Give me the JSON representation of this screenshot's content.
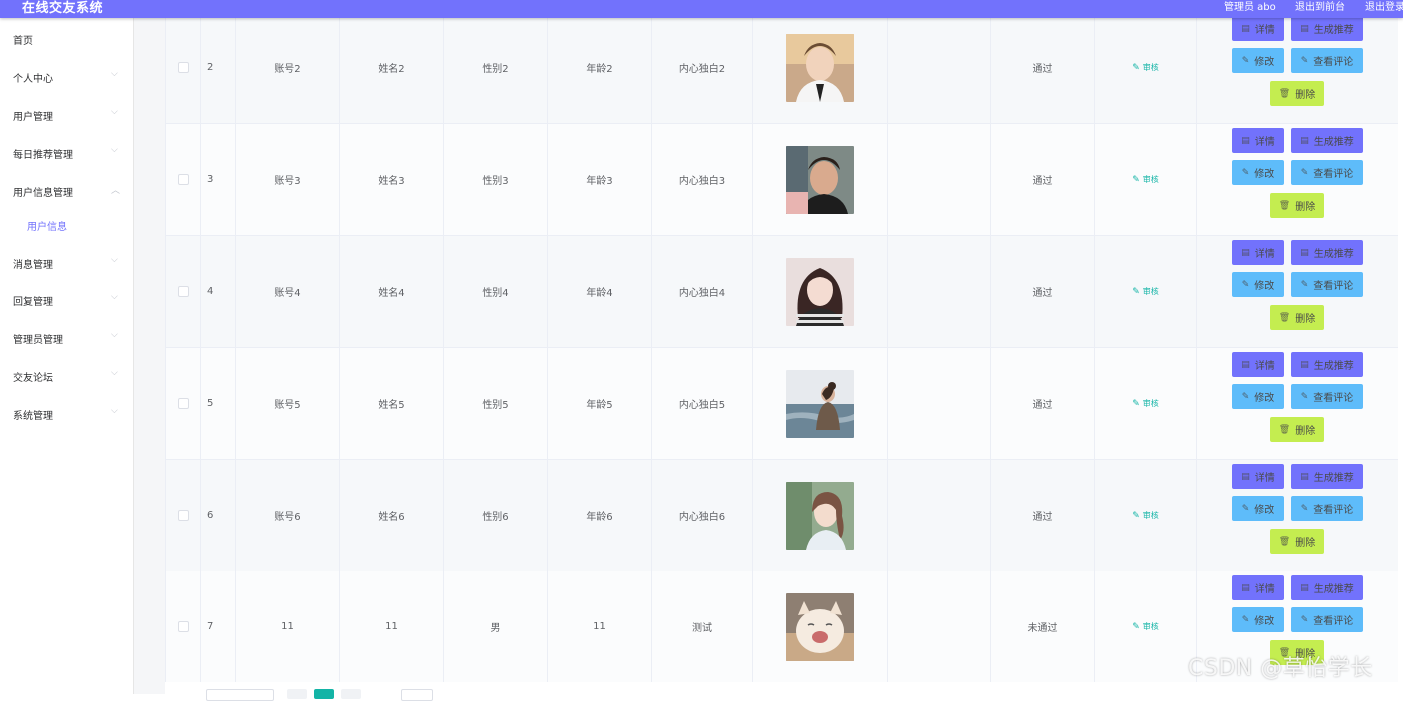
{
  "header": {
    "title": "在线交友系统",
    "admin": "管理员 abo",
    "to_front": "退出到前台",
    "logout": "退出登录"
  },
  "sidebar": {
    "items": [
      {
        "label": "首页"
      },
      {
        "label": "个人中心"
      },
      {
        "label": "用户管理"
      },
      {
        "label": "每日推荐管理"
      },
      {
        "label": "用户信息管理"
      },
      {
        "label": "用户信息"
      },
      {
        "label": "消息管理"
      },
      {
        "label": "回复管理"
      },
      {
        "label": "管理员管理"
      },
      {
        "label": "交友论坛"
      },
      {
        "label": "系统管理"
      }
    ]
  },
  "actions": {
    "audit": "审核",
    "detail": "详情",
    "recommend": "生成推荐",
    "edit": "修改",
    "comments": "查看评论",
    "delete": "删除"
  },
  "rows": [
    {
      "index": "2",
      "account": "账号2",
      "name": "姓名2",
      "gender": "性别2",
      "age": "年龄2",
      "monologue": "内心独白2",
      "status": "通过"
    },
    {
      "index": "3",
      "account": "账号3",
      "name": "姓名3",
      "gender": "性别3",
      "age": "年龄3",
      "monologue": "内心独白3",
      "status": "通过"
    },
    {
      "index": "4",
      "account": "账号4",
      "name": "姓名4",
      "gender": "性别4",
      "age": "年龄4",
      "monologue": "内心独白4",
      "status": "通过"
    },
    {
      "index": "5",
      "account": "账号5",
      "name": "姓名5",
      "gender": "性别5",
      "age": "年龄5",
      "monologue": "内心独白5",
      "status": "通过"
    },
    {
      "index": "6",
      "account": "账号6",
      "name": "姓名6",
      "gender": "性别6",
      "age": "年龄6",
      "monologue": "内心独白6",
      "status": "通过"
    },
    {
      "index": "7",
      "account": "11",
      "name": "11",
      "gender": "男",
      "age": "11",
      "monologue": "测试",
      "status": "未通过"
    }
  ],
  "watermark": "CSDN @草怡学长",
  "colors": {
    "primary": "#7272fc",
    "info": "#5ebcfa",
    "danger": "#c4ed50",
    "success": "#13b4a6"
  }
}
